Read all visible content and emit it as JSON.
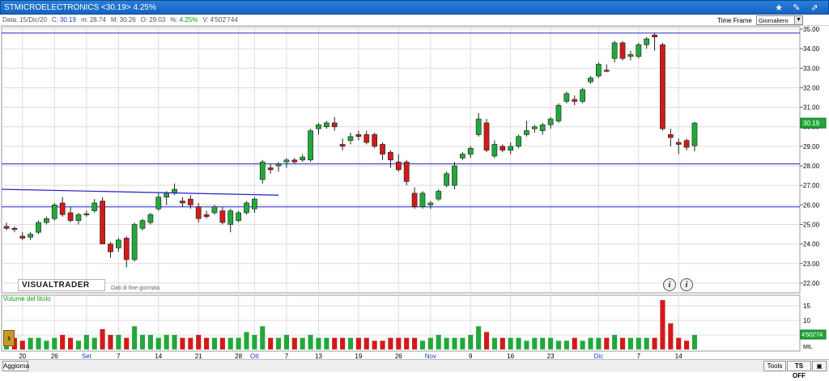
{
  "window": {
    "title": "STMICROELECTRONICS <30.19> 4.25%"
  },
  "infobar": {
    "data_label": "Data:",
    "data": "15/Dic/20",
    "c_label": "C:",
    "c": "30.19",
    "m_label": "m:",
    "m": "28.74",
    "M_label": "M:",
    "M": "30.26",
    "o_label": "O:",
    "o": "29.03",
    "pct_label": "%:",
    "pct": "4.25%",
    "v_label": "V:",
    "v": "4'502'744"
  },
  "timeframe": {
    "label": "Time Frame",
    "value": "Giornaliero"
  },
  "branding": {
    "logo": "VISUALTRADER",
    "subtitle": "Dati di fine giornata"
  },
  "volume_panel": {
    "title": "Volume del titolo",
    "current_tag": "4'502'74",
    "unit": "MIL"
  },
  "price_tag": "30.19",
  "bottombar": {
    "refresh": "Aggiorna",
    "tools": "Tools",
    "ts_off": "TS OFF"
  },
  "colors": {
    "up": "#22a83a",
    "down": "#d11a1a",
    "trendline": "#2020c8",
    "hline": "#2020c8",
    "grid": "#dcdcdc"
  },
  "icons": [
    "star-icon",
    "pen-icon",
    "drawing-tool-icon",
    "chevron-right-icon",
    "info-icon"
  ],
  "chart_data": [
    {
      "type": "candlestick",
      "title": "STMICROELECTRONICS <30.19> 4.25%",
      "ylim": [
        21.5,
        35.0
      ],
      "yticks": [
        "35.00",
        "34.00",
        "33.00",
        "32.00",
        "31.00",
        "30.00",
        "29.00",
        "28.00",
        "27.00",
        "26.00",
        "25.00",
        "24.00",
        "23.00",
        "22.00"
      ],
      "xticks": [
        "20",
        "26",
        "Set",
        "7",
        "14",
        "21",
        "28",
        "Ott",
        "7",
        "13",
        "19",
        "26",
        "Nov",
        "9",
        "16",
        "23",
        "Dic",
        "7",
        "14"
      ],
      "ohlc": [
        [
          24.9,
          25.1,
          24.7,
          24.8
        ],
        [
          24.8,
          24.9,
          24.6,
          24.75
        ],
        [
          24.4,
          24.6,
          24.2,
          24.3
        ],
        [
          24.35,
          24.6,
          24.2,
          24.5
        ],
        [
          24.6,
          25.2,
          24.5,
          25.1
        ],
        [
          25.1,
          25.4,
          25.0,
          25.3
        ],
        [
          25.3,
          26.1,
          25.2,
          26.0
        ],
        [
          26.1,
          26.4,
          25.4,
          25.5
        ],
        [
          25.6,
          25.9,
          25.1,
          25.2
        ],
        [
          25.2,
          25.6,
          25.0,
          25.5
        ],
        [
          25.55,
          25.7,
          25.4,
          25.55
        ],
        [
          25.7,
          26.3,
          25.6,
          26.1
        ],
        [
          26.2,
          26.4,
          24.1,
          24.0
        ],
        [
          24.0,
          24.1,
          23.3,
          23.6
        ],
        [
          23.8,
          24.3,
          23.6,
          24.2
        ],
        [
          24.3,
          24.4,
          22.8,
          23.2
        ],
        [
          23.2,
          25.1,
          23.1,
          25.0
        ],
        [
          24.8,
          25.3,
          24.7,
          25.2
        ],
        [
          25.1,
          25.6,
          25.0,
          25.5
        ],
        [
          25.8,
          26.6,
          25.7,
          26.4
        ],
        [
          26.4,
          26.7,
          26.0,
          26.6
        ],
        [
          26.6,
          27.1,
          26.5,
          26.8
        ],
        [
          26.2,
          26.4,
          25.9,
          26.1
        ],
        [
          26.3,
          26.5,
          25.8,
          26.0
        ],
        [
          25.9,
          26.1,
          25.1,
          25.3
        ],
        [
          25.5,
          25.7,
          25.3,
          25.4
        ],
        [
          25.6,
          26.0,
          25.5,
          25.9
        ],
        [
          25.7,
          25.9,
          25.0,
          25.1
        ],
        [
          25.0,
          25.8,
          24.6,
          25.7
        ],
        [
          25.2,
          25.7,
          25.1,
          25.6
        ],
        [
          25.6,
          26.2,
          25.5,
          26.1
        ],
        [
          25.8,
          26.4,
          25.6,
          26.3
        ],
        [
          27.3,
          28.3,
          27.1,
          28.2
        ],
        [
          27.9,
          28.1,
          27.6,
          27.8
        ],
        [
          28.0,
          28.2,
          27.7,
          28.1
        ],
        [
          28.2,
          28.4,
          27.9,
          28.3
        ],
        [
          28.3,
          28.4,
          28.1,
          28.2
        ],
        [
          28.3,
          28.6,
          28.2,
          28.45
        ],
        [
          28.3,
          29.9,
          28.2,
          29.8
        ],
        [
          29.9,
          30.2,
          29.6,
          30.1
        ],
        [
          30.0,
          30.3,
          29.9,
          30.2
        ],
        [
          30.2,
          30.5,
          29.8,
          30.0
        ],
        [
          29.1,
          29.4,
          28.8,
          29.0
        ],
        [
          29.3,
          29.7,
          29.1,
          29.5
        ],
        [
          29.6,
          29.8,
          29.3,
          29.5
        ],
        [
          29.6,
          29.8,
          29.1,
          29.2
        ],
        [
          29.6,
          29.7,
          28.9,
          29.0
        ],
        [
          29.1,
          29.2,
          28.3,
          28.6
        ],
        [
          28.7,
          28.8,
          27.9,
          28.3
        ],
        [
          28.2,
          28.6,
          27.7,
          27.8
        ],
        [
          28.2,
          28.3,
          27.0,
          27.2
        ],
        [
          26.6,
          26.9,
          25.8,
          25.9
        ],
        [
          25.9,
          26.7,
          25.8,
          26.6
        ],
        [
          26.0,
          26.2,
          25.8,
          26.1
        ],
        [
          26.3,
          26.8,
          26.2,
          26.7
        ],
        [
          27.0,
          27.7,
          26.9,
          27.6
        ],
        [
          27.0,
          28.2,
          26.8,
          28.0
        ],
        [
          28.4,
          28.7,
          28.3,
          28.6
        ],
        [
          28.6,
          29.0,
          28.4,
          28.9
        ],
        [
          29.6,
          30.7,
          29.5,
          30.4
        ],
        [
          30.2,
          30.4,
          28.7,
          28.8
        ],
        [
          28.5,
          29.3,
          28.4,
          29.1
        ],
        [
          29.0,
          29.1,
          28.7,
          28.8
        ],
        [
          28.8,
          29.2,
          28.6,
          29.0
        ],
        [
          29.0,
          29.6,
          28.9,
          29.5
        ],
        [
          29.6,
          30.3,
          29.5,
          29.8
        ],
        [
          29.9,
          30.1,
          29.7,
          30.0
        ],
        [
          29.8,
          30.2,
          29.6,
          30.1
        ],
        [
          30.1,
          30.5,
          29.9,
          30.4
        ],
        [
          30.3,
          31.2,
          30.2,
          31.1
        ],
        [
          31.3,
          31.8,
          31.2,
          31.7
        ],
        [
          31.4,
          31.6,
          31.1,
          31.3
        ],
        [
          31.3,
          32.0,
          31.2,
          31.9
        ],
        [
          32.3,
          32.6,
          32.2,
          32.5
        ],
        [
          32.6,
          33.3,
          32.5,
          33.2
        ],
        [
          32.9,
          33.2,
          32.8,
          32.85
        ],
        [
          33.5,
          34.4,
          33.3,
          34.3
        ],
        [
          34.3,
          34.4,
          33.4,
          33.5
        ],
        [
          33.6,
          33.9,
          33.4,
          33.7
        ],
        [
          33.6,
          34.3,
          33.5,
          34.2
        ],
        [
          34.2,
          34.6,
          34.0,
          34.5
        ],
        [
          34.7,
          34.8,
          33.9,
          34.6
        ],
        [
          34.2,
          34.3,
          29.8,
          29.9
        ],
        [
          29.6,
          29.9,
          29.0,
          29.45
        ],
        [
          29.2,
          29.4,
          28.6,
          29.1
        ],
        [
          29.3,
          29.4,
          28.8,
          28.95
        ],
        [
          29.03,
          30.26,
          28.74,
          30.19
        ]
      ],
      "trendline": {
        "from_index": 0,
        "to_index": 34,
        "y_start": 26.8,
        "y_end": 26.5
      },
      "horizontal_lines": [
        34.8,
        28.1,
        25.9
      ]
    },
    {
      "type": "bar",
      "title": "Volume del titolo",
      "ylim": [
        0,
        17
      ],
      "yticks": [
        "15",
        "10",
        "5"
      ],
      "values": [
        4,
        4,
        3,
        4,
        4,
        3,
        4,
        5,
        4,
        3,
        5,
        4,
        7,
        5,
        5,
        4,
        8,
        5,
        5,
        4,
        5,
        5,
        4,
        4,
        5,
        4,
        4,
        4,
        4,
        4,
        6,
        5,
        8,
        4,
        4,
        5,
        4,
        4,
        5,
        4,
        4,
        4,
        4,
        4,
        4,
        4,
        3,
        3,
        4,
        4,
        4,
        4,
        3,
        4,
        5,
        4,
        4,
        4,
        5,
        8,
        6,
        4,
        4,
        4,
        4,
        3,
        4,
        4,
        4,
        3,
        3,
        4,
        3,
        4,
        4,
        4,
        5,
        4,
        4,
        4,
        4,
        4,
        17,
        9,
        4,
        3,
        5
      ],
      "up_flags": [
        1,
        0,
        0,
        1,
        1,
        1,
        1,
        0,
        0,
        1,
        1,
        1,
        0,
        0,
        1,
        0,
        1,
        1,
        1,
        1,
        1,
        1,
        0,
        0,
        0,
        0,
        1,
        0,
        1,
        1,
        1,
        1,
        1,
        0,
        1,
        1,
        0,
        1,
        1,
        1,
        1,
        0,
        0,
        1,
        0,
        0,
        0,
        0,
        0,
        0,
        0,
        0,
        1,
        1,
        1,
        1,
        1,
        1,
        1,
        1,
        0,
        1,
        0,
        1,
        1,
        1,
        1,
        1,
        1,
        1,
        1,
        0,
        1,
        1,
        1,
        0,
        1,
        0,
        1,
        1,
        1,
        0,
        0,
        0,
        0,
        0,
        1
      ]
    }
  ]
}
